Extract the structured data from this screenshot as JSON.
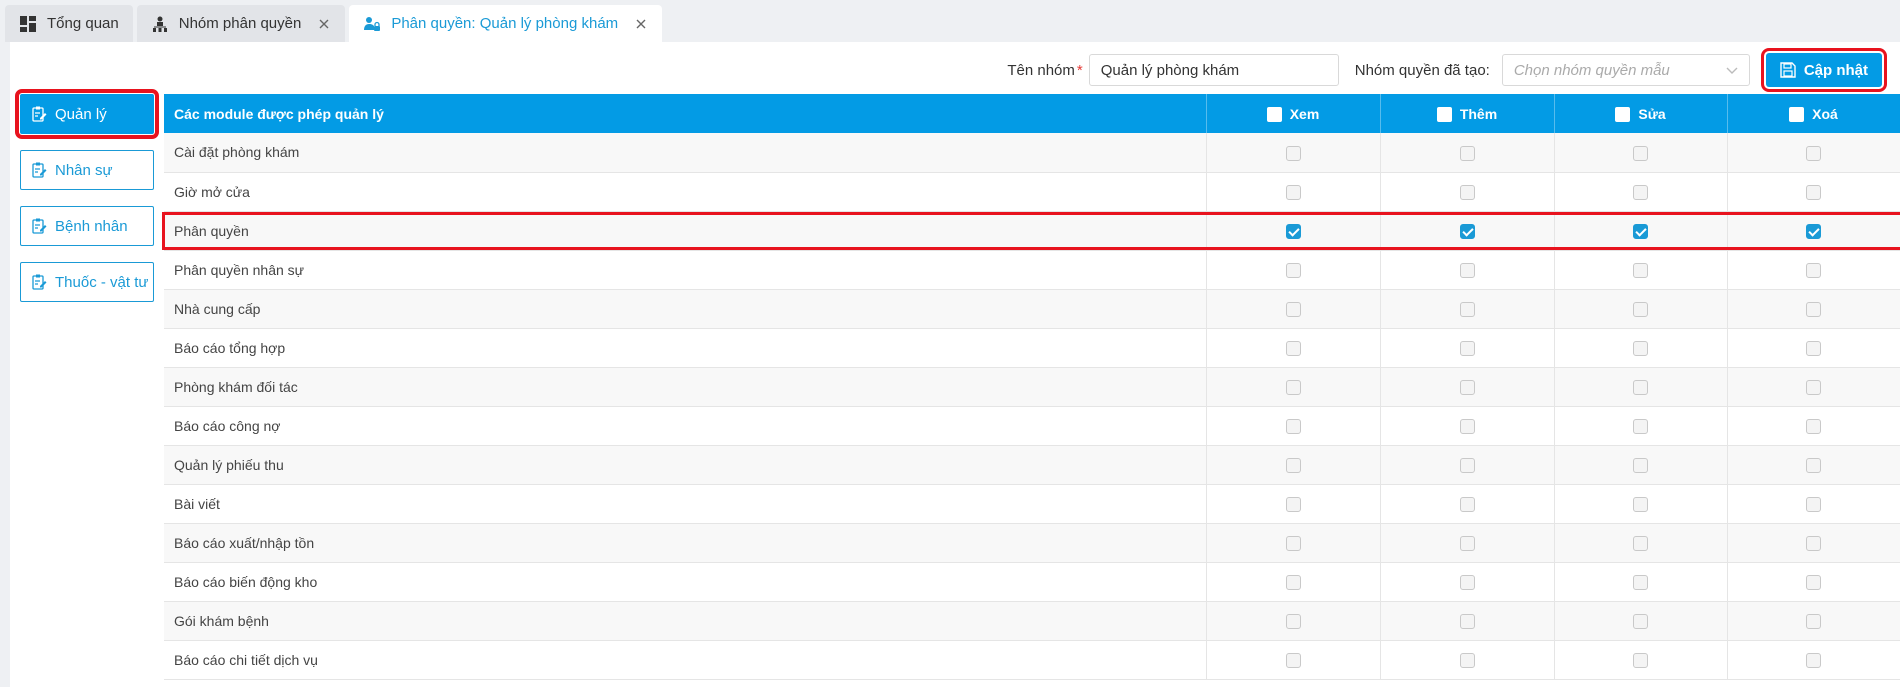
{
  "tabs": [
    {
      "label": "Tổng quan",
      "icon": "dashboard-icon",
      "closable": false,
      "active": false
    },
    {
      "label": "Nhóm phân quyền",
      "icon": "org-chart-icon",
      "closable": true,
      "active": false
    },
    {
      "label": "Phân quyền: Quản lý phòng khám",
      "icon": "users-lock-icon",
      "closable": true,
      "active": true
    }
  ],
  "toolbar": {
    "group_name_label": "Tên nhóm",
    "required_mark": "*",
    "group_name_value": "Quản lý phòng khám",
    "template_label": "Nhóm quyền đã tạo:",
    "template_placeholder": "Chọn nhóm quyền mẫu",
    "update_label": "Cập nhật"
  },
  "leftmenu": {
    "items": [
      {
        "label": "Quản lý",
        "active": true
      },
      {
        "label": "Nhân sự",
        "active": false
      },
      {
        "label": "Bệnh nhân",
        "active": false
      },
      {
        "label": "Thuốc - vật tư",
        "active": false
      }
    ]
  },
  "table": {
    "headers": {
      "module": "Các module được phép quản lý",
      "view": "Xem",
      "add": "Thêm",
      "edit": "Sửa",
      "delete": "Xoá"
    },
    "rows": [
      {
        "name": "Cài đặt phòng khám",
        "view": false,
        "add": false,
        "edit": false,
        "delete": false
      },
      {
        "name": "Giờ mở cửa",
        "view": false,
        "add": false,
        "edit": false,
        "delete": false
      },
      {
        "name": "Phân quyền",
        "view": true,
        "add": true,
        "edit": true,
        "delete": true
      },
      {
        "name": "Phân quyền nhân sự",
        "view": false,
        "add": false,
        "edit": false,
        "delete": false
      },
      {
        "name": "Nhà cung cấp",
        "view": false,
        "add": false,
        "edit": false,
        "delete": false
      },
      {
        "name": "Báo cáo tổng hợp",
        "view": false,
        "add": false,
        "edit": false,
        "delete": false
      },
      {
        "name": "Phòng khám đối tác",
        "view": false,
        "add": false,
        "edit": false,
        "delete": false
      },
      {
        "name": "Báo cáo công nợ",
        "view": false,
        "add": false,
        "edit": false,
        "delete": false
      },
      {
        "name": "Quản lý phiếu thu",
        "view": false,
        "add": false,
        "edit": false,
        "delete": false
      },
      {
        "name": "Bài viết",
        "view": false,
        "add": false,
        "edit": false,
        "delete": false
      },
      {
        "name": "Báo cáo xuất/nhập tồn",
        "view": false,
        "add": false,
        "edit": false,
        "delete": false
      },
      {
        "name": "Báo cáo biến động kho",
        "view": false,
        "add": false,
        "edit": false,
        "delete": false
      },
      {
        "name": "Gói khám bệnh",
        "view": false,
        "add": false,
        "edit": false,
        "delete": false
      },
      {
        "name": "Báo cáo chi tiết dịch vụ",
        "view": false,
        "add": false,
        "edit": false,
        "delete": false
      }
    ]
  },
  "colors": {
    "accent": "#039be5",
    "highlight": "#e8131e"
  }
}
